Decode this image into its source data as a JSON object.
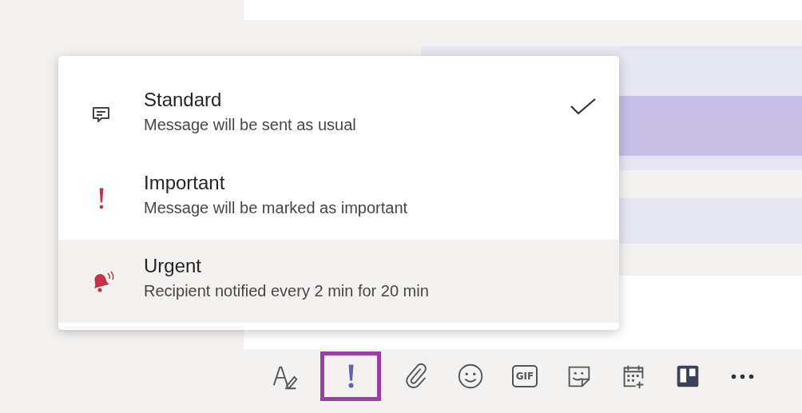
{
  "menu": {
    "items": [
      {
        "kind": "standard",
        "title": "Standard",
        "description": "Message will be sent as usual",
        "selected": true,
        "highlighted": false
      },
      {
        "kind": "important",
        "title": "Important",
        "description": "Message will be marked as important",
        "selected": false,
        "highlighted": false
      },
      {
        "kind": "urgent",
        "title": "Urgent",
        "description": "Recipient notified every 2 min for 20 min",
        "selected": false,
        "highlighted": true
      }
    ]
  },
  "toolbar": {
    "buttons": [
      {
        "kind": "format",
        "selected": false
      },
      {
        "kind": "priority",
        "selected": true
      },
      {
        "kind": "attach",
        "selected": false
      },
      {
        "kind": "emoji",
        "selected": false
      },
      {
        "kind": "gif",
        "label": "GIF",
        "selected": false
      },
      {
        "kind": "sticker",
        "selected": false
      },
      {
        "kind": "schedule",
        "selected": false
      },
      {
        "kind": "board",
        "selected": false
      },
      {
        "kind": "more",
        "selected": false
      }
    ]
  }
}
